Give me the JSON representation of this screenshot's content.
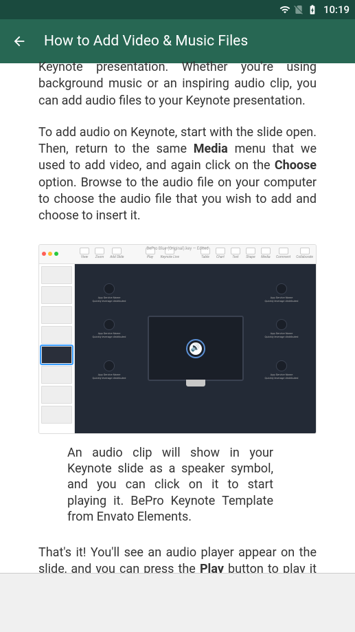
{
  "status": {
    "time": "10:19"
  },
  "header": {
    "title": "How to Add Video & Music Files"
  },
  "article": {
    "p1": "Keynote presentation. Whether you're using background music or an inspiring audio clip, you can add audio files to your Keynote presentation.",
    "p2_pre": "To add audio on Keynote, start with the slide open. Then, return to the same ",
    "p2_b1": "Media",
    "p2_mid": " menu that we used to add video, and again click on the ",
    "p2_b2": "Choose",
    "p2_post": " option. Browse to the audio file on your computer to choose the audio file that you wish to add and choose to insert it.",
    "caption": "An audio clip will show in your Keynote slide as a speaker symbol, and you can click on it to start playing it. BePro Keynote Template from Envato Elements.",
    "p3_pre": "That's it! You'll see an audio player appear on the slide, and you can press the ",
    "p3_b1": "Play",
    "p3_post": " button to play it on the slide. But, that's not all there is to it—let's also look at how to adjust how the audio plays."
  },
  "keynote": {
    "window_title": "BePro Blue (Original).key — Edited",
    "toolbar": [
      "View",
      "Zoom",
      "Add Slide",
      "Play",
      "Keynote Live",
      "Table",
      "Chart",
      "Text",
      "Shape",
      "Media",
      "Comment",
      "Collaborate"
    ],
    "card_label1": "App Service Name",
    "card_label2": "Quickly leverage distributed",
    "speaker_glyph": "🔊"
  }
}
